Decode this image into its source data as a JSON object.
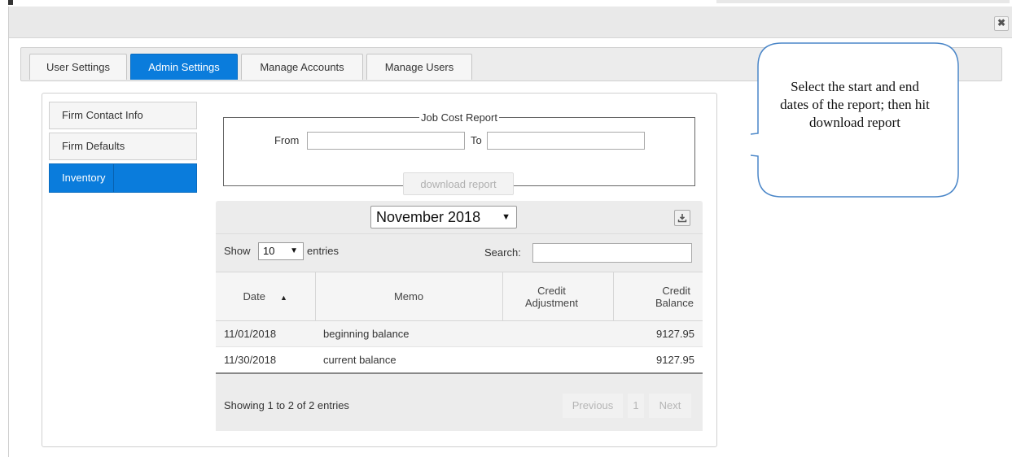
{
  "window": {
    "close_glyph": "✖"
  },
  "tabs": [
    {
      "label": "User Settings",
      "active": false
    },
    {
      "label": "Admin Settings",
      "active": true
    },
    {
      "label": "Manage Accounts",
      "active": false
    },
    {
      "label": "Manage Users",
      "active": false
    }
  ],
  "sidebar": {
    "items": [
      {
        "label": "Firm Contact Info",
        "active": false
      },
      {
        "label": "Firm Defaults",
        "active": false
      },
      {
        "label": "Inventory",
        "active": true
      }
    ]
  },
  "job_cost_report": {
    "legend": "Job Cost Report",
    "from_label": "From",
    "from_value": "",
    "to_label": "To",
    "to_value": "",
    "download_label": "download report"
  },
  "inventory": {
    "month_selected": "November 2018",
    "download_icon": "download-icon",
    "show_label": "Show",
    "entries_value": "10",
    "entries_label": "entries",
    "search_label": "Search:",
    "search_value": "",
    "columns": [
      "Date",
      "Memo",
      "Credit Adjustment",
      "Credit Balance"
    ],
    "column_lines": [
      [
        "Date"
      ],
      [
        "Memo"
      ],
      [
        "Credit",
        "Adjustment"
      ],
      [
        "Credit",
        "Balance"
      ]
    ],
    "rows": [
      {
        "date": "11/01/2018",
        "memo": "beginning balance",
        "adjustment": "",
        "balance": "9127.95"
      },
      {
        "date": "11/30/2018",
        "memo": "current balance",
        "adjustment": "",
        "balance": "9127.95"
      }
    ],
    "info": "Showing 1 to 2 of 2 entries",
    "pagination": {
      "previous": "Previous",
      "page": "1",
      "next": "Next"
    }
  },
  "callout": {
    "text": "Select the start and end dates of the report; then hit download report",
    "stroke": "#4a86c8"
  },
  "colors": {
    "accent": "#0a7cdc"
  }
}
